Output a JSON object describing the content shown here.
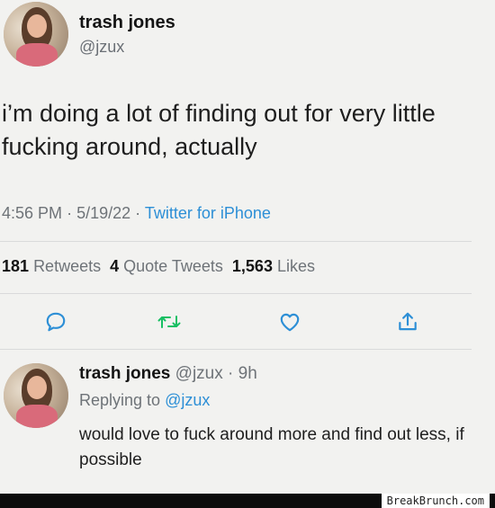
{
  "tweet": {
    "author_name": "trash jones",
    "author_handle": "@jzux",
    "text": "i’m doing a lot of finding out for very little fucking around, actually",
    "time": "4:56 PM",
    "date": "5/19/22",
    "source": "Twitter for iPhone",
    "separator": "·"
  },
  "stats": {
    "retweets_count": "181",
    "retweets_label": "Retweets",
    "quotes_count": "4",
    "quotes_label": "Quote Tweets",
    "likes_count": "1,563",
    "likes_label": "Likes"
  },
  "actions": {
    "icons": [
      "reply-icon",
      "retweet-icon",
      "like-icon",
      "share-icon"
    ],
    "accent": "#2d8fd6",
    "retweet_color": "#17bf63"
  },
  "reply": {
    "author_name": "trash jones",
    "author_handle": "@jzux",
    "age": "9h",
    "replying_prefix": "Replying to",
    "replying_to": "@jzux",
    "text": "would love to fuck around more and find out less, if possible"
  },
  "watermark": "BreakBrunch.com"
}
